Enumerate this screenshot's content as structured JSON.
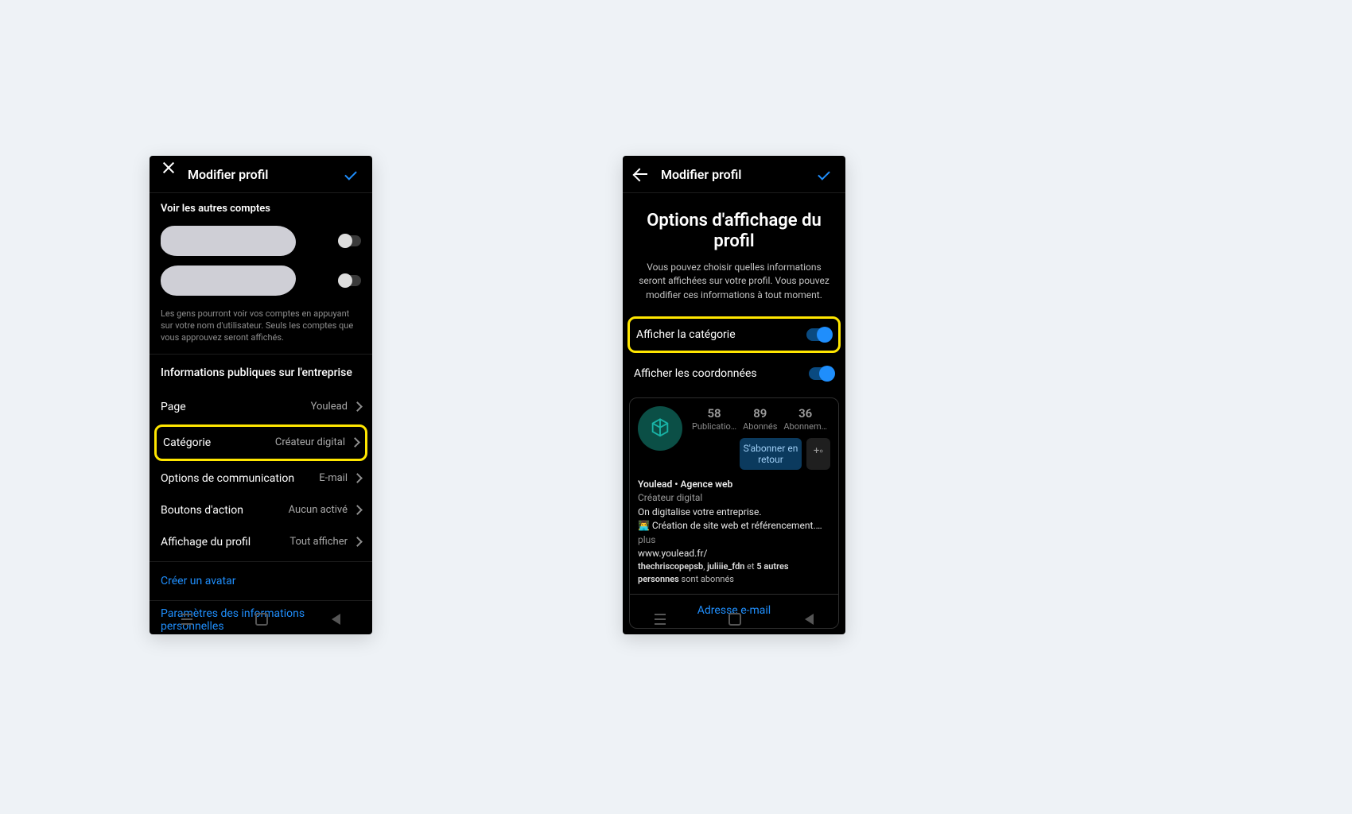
{
  "left": {
    "header": {
      "title": "Modifier profil"
    },
    "voir_autres": "Voir les autres comptes",
    "helper": "Les gens pourront voir vos comptes en appuyant sur votre nom d'utilisateur. Seuls les comptes que vous approuvez seront affichés.",
    "section_infos": "Informations publiques sur l'entreprise",
    "rows": {
      "page": {
        "label": "Page",
        "value": "Youlead"
      },
      "cat": {
        "label": "Catégorie",
        "value": "Créateur digital"
      },
      "comm": {
        "label": "Options de communication",
        "value": "E-mail"
      },
      "action": {
        "label": "Boutons d'action",
        "value": "Aucun activé"
      },
      "aff": {
        "label": "Affichage du profil",
        "value": "Tout afficher"
      }
    },
    "avatar_link": "Créer un avatar",
    "params_link": "Paramètres des informations personnelles"
  },
  "right": {
    "header": {
      "title": "Modifier profil"
    },
    "big_title": "Options d'affichage du profil",
    "descr": "Vous pouvez choisir quelles informations seront affichées sur votre profil. Vous pouvez modifier ces informations à tout moment.",
    "toggles": {
      "cat": "Afficher la catégorie",
      "coord": "Afficher les coordonnées"
    },
    "preview": {
      "stats": {
        "pub": {
          "n": "58",
          "l": "Publicatio…"
        },
        "abonnes": {
          "n": "89",
          "l": "Abonnés"
        },
        "abonn": {
          "n": "36",
          "l": "Abonnem…"
        }
      },
      "follow_btn": "S'abonner en retour",
      "name": "Youlead • Agence web",
      "cat": "Créateur digital",
      "tag": "On digitalise votre entreprise.",
      "line2_a": "👨‍💻 Création de site web et référencement.…",
      "line2_more": " plus",
      "url": "www.youlead.fr/",
      "mutual_a": "thechriscopepsb",
      "mutual_b": "juliiie_fdn",
      "mutual_rest": " et ",
      "mutual_c": "5 autres personnes",
      "mutual_end": " sont abonnés",
      "footer": "Adresse e-mail"
    }
  }
}
